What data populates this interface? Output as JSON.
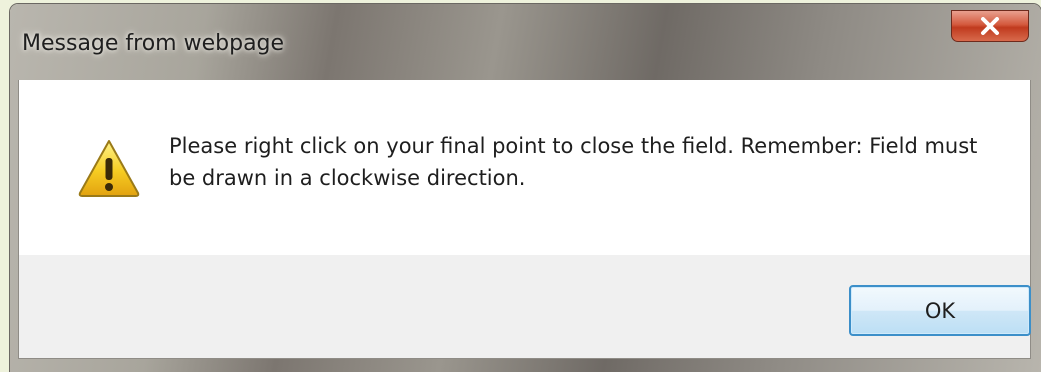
{
  "dialog": {
    "title": "Message from webpage",
    "close_icon": "close-icon",
    "message": "Please right click on your final point to close the field. Remember: Field must be drawn in a clockwise direction.",
    "icon": "warning-icon",
    "ok_label": "OK"
  },
  "colors": {
    "close_button": "#c8462a",
    "ok_border": "#3c8fc9",
    "warning_fill": "#f3c21a"
  }
}
